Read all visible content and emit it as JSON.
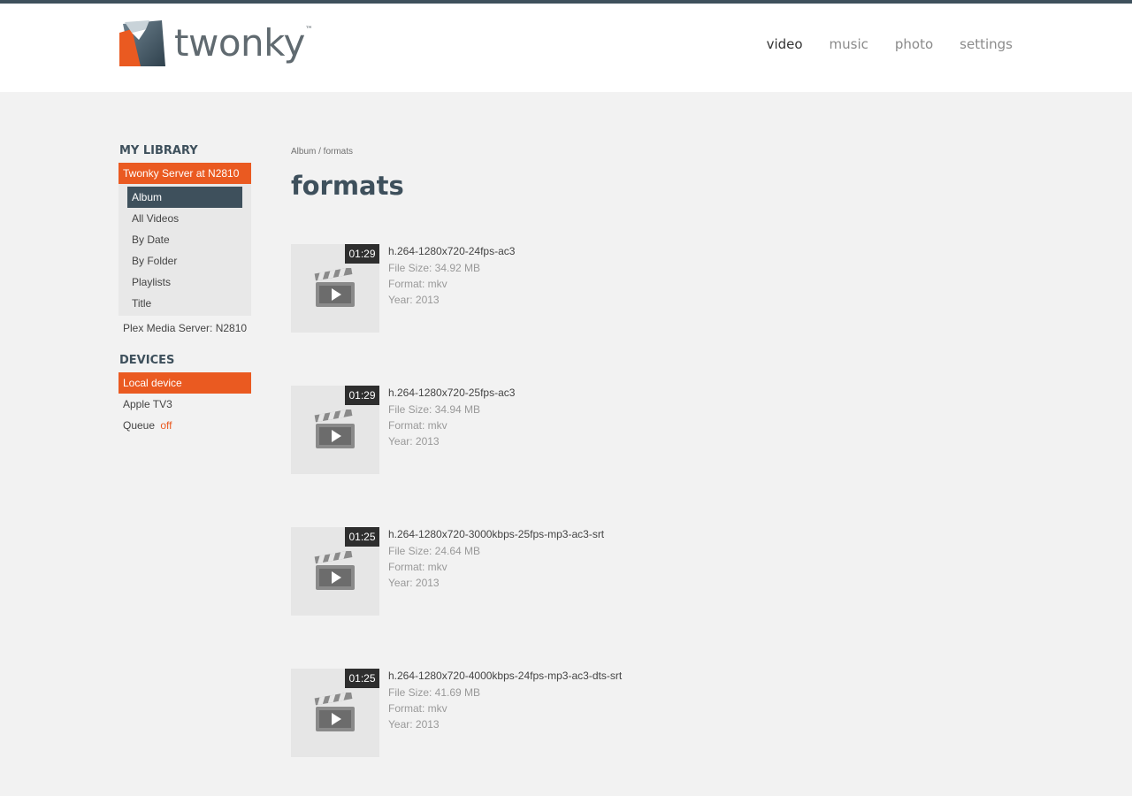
{
  "app": {
    "logo_text": "twonky",
    "logo_tm": "™"
  },
  "colors": {
    "accent": "#ea5a21",
    "dark": "#3e505c",
    "background": "#f2f2f2"
  },
  "nav": {
    "items": [
      {
        "label": "video",
        "active": true
      },
      {
        "label": "music",
        "active": false
      },
      {
        "label": "photo",
        "active": false
      },
      {
        "label": "settings",
        "active": false
      }
    ]
  },
  "sidebar": {
    "library_title": "MY LIBRARY",
    "active_server": "Twonky Server at N2810",
    "sub_items": [
      {
        "label": "Album",
        "active": true
      },
      {
        "label": "All Videos",
        "active": false
      },
      {
        "label": "By Date",
        "active": false
      },
      {
        "label": "By Folder",
        "active": false
      },
      {
        "label": "Playlists",
        "active": false
      },
      {
        "label": "Title",
        "active": false
      }
    ],
    "other_server": "Plex Media Server: N2810",
    "devices_title": "DEVICES",
    "active_device": "Local device",
    "devices": [
      "Apple TV3"
    ],
    "queue_label": "Queue",
    "queue_state": "off"
  },
  "main": {
    "breadcrumb": "Album / formats",
    "title": "formats",
    "videos": [
      {
        "duration": "01:29",
        "title": "h.264-1280x720-24fps-ac3",
        "file_size": "File Size: 34.92 MB",
        "format": "Format: mkv",
        "year": "Year: 2013"
      },
      {
        "duration": "01:29",
        "title": "h.264-1280x720-25fps-ac3",
        "file_size": "File Size: 34.94 MB",
        "format": "Format: mkv",
        "year": "Year: 2013"
      },
      {
        "duration": "01:25",
        "title": "h.264-1280x720-3000kbps-25fps-mp3-ac3-srt",
        "file_size": "File Size: 24.64 MB",
        "format": "Format: mkv",
        "year": "Year: 2013"
      },
      {
        "duration": "01:25",
        "title": "h.264-1280x720-4000kbps-24fps-mp3-ac3-dts-srt",
        "file_size": "File Size: 41.69 MB",
        "format": "Format: mkv",
        "year": "Year: 2013"
      }
    ]
  }
}
